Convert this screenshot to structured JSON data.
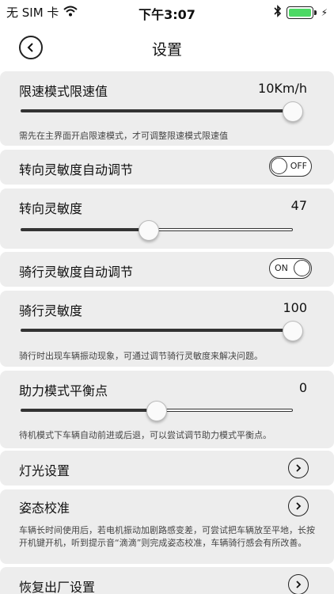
{
  "status_bar": {
    "carrier": "无 SIM 卡",
    "time": "下午3:07"
  },
  "nav": {
    "title": "设置"
  },
  "speed_limit": {
    "title": "限速模式限速值",
    "value": "10Km/h",
    "fraction": 1.0,
    "desc": "需先在主界面开启限速模式，才可调整限速模式限速值"
  },
  "steer_auto": {
    "title": "转向灵敏度自动调节",
    "toggle_label": "OFF",
    "on": false
  },
  "steer_sens": {
    "title": "转向灵敏度",
    "value": "47",
    "fraction": 0.47
  },
  "ride_auto": {
    "title": "骑行灵敏度自动调节",
    "toggle_label": "ON",
    "on": true
  },
  "ride_sens": {
    "title": "骑行灵敏度",
    "value": "100",
    "fraction": 1.0,
    "desc": "骑行时出现车辆振动现象，可通过调节骑行灵敏度来解决问题。"
  },
  "assist_balance": {
    "title": "助力模式平衡点",
    "value": "0",
    "fraction": 0.5,
    "desc": "待机模式下车辆自动前进或后退，可以尝试调节助力模式平衡点。"
  },
  "lights": {
    "title": "灯光设置"
  },
  "calibration": {
    "title": "姿态校准",
    "desc": "车辆长时间使用后，若电机振动加剧路感变差，可尝试把车辆放至平地，长按开机键开机，听到提示音“滴滴”则完成姿态校准，车辆骑行感会有所改善。"
  },
  "factory_reset": {
    "title": "恢复出厂设置"
  }
}
